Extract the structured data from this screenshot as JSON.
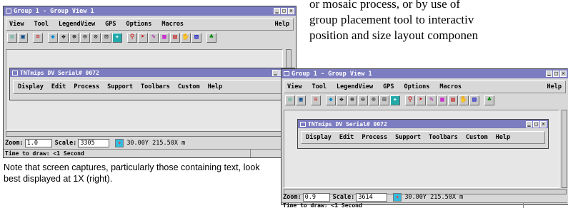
{
  "paragraph": {
    "lines": [
      "or mosaic process, or by use of",
      "group placement tool to interactiv",
      "position and size layout componen"
    ]
  },
  "caption": {
    "text": "Note that screen captures, particularly those containing text, look best displayed at 1X (right)."
  },
  "left_window": {
    "title": "Group 1 - Group View 1",
    "menu": [
      "View",
      "Tool",
      "LegendView",
      "GPS",
      "Options",
      "Macros"
    ],
    "help": "Help",
    "toolbar_icons": [
      "display-icon",
      "window-icon",
      "layer-icon",
      "select-icon",
      "pan-icon",
      "zoom-in-icon",
      "zoom-out-icon",
      "zoom-full-icon",
      "zoom-box-icon",
      "gps-icon",
      "search-icon",
      "pointer-icon",
      "edit-icon",
      "raster-icon",
      "object-icon",
      "hand-icon",
      "map-icon"
    ],
    "zoom_label": "Zoom:",
    "zoom_value": "1.0",
    "scale_label": "Scale:",
    "scale_value": "3305",
    "coords": "30.00Y  215.50X  m",
    "time_text": "Time to draw: <1 Second",
    "dv": {
      "title": "TNTmips DV  Serial# 0072",
      "menu": [
        "Display",
        "Edit",
        "Process",
        "Support",
        "Toolbars",
        "Custom"
      ],
      "help": "Help"
    }
  },
  "right_window": {
    "title": "Group 1 - Group View 1",
    "menu": [
      "View",
      "Tool",
      "LegendView",
      "GPS",
      "Options",
      "Macros"
    ],
    "help": "Help",
    "zoom_label": "Zoom:",
    "zoom_value": "0.9",
    "scale_label": "Scale:",
    "scale_value": "3614",
    "coords": "30.00Y  215.50X  m",
    "time_text": "Time to draw: <1 Second",
    "dv": {
      "title": "TNTmips DV  Serial# 0072",
      "menu": [
        "Display",
        "Edit",
        "Process",
        "Support",
        "Toolbars",
        "Custom"
      ],
      "help": "Help"
    }
  }
}
